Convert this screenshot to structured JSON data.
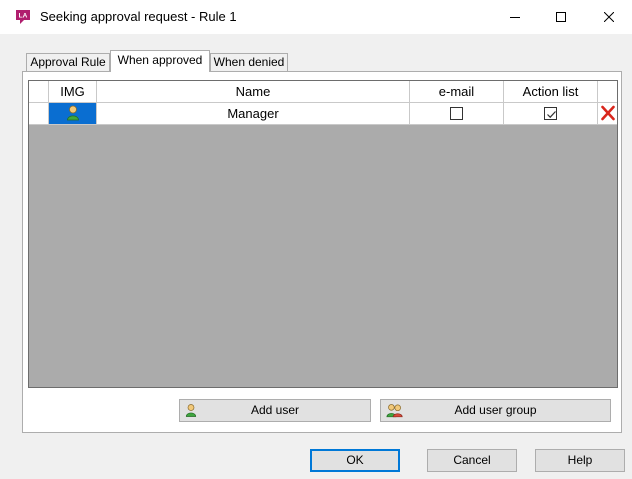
{
  "window": {
    "title": "Seeking approval request - Rule 1",
    "app_icon_label": "LA",
    "minimize_label": "minimize",
    "maximize_label": "maximize",
    "close_label": "close"
  },
  "tabs": [
    {
      "label": "Approval Rule",
      "active": false
    },
    {
      "label": "When approved",
      "active": true
    },
    {
      "label": "When denied",
      "active": false
    }
  ],
  "grid": {
    "columns": [
      "IMG",
      "Name",
      "e-mail",
      "Action list"
    ],
    "rows": [
      {
        "img": "user-icon",
        "name": "Manager",
        "email": false,
        "action_list": true,
        "selected_cell": "img"
      }
    ]
  },
  "panel_buttons": {
    "add_user": "Add user",
    "add_user_group": "Add user group"
  },
  "dialog_buttons": {
    "ok": "OK",
    "cancel": "Cancel",
    "help": "Help"
  },
  "colors": {
    "grid_background": "#ababab",
    "selection": "#0a6ed1",
    "delete_icon": "#d9261c",
    "app_icon": "#b01e6e"
  }
}
